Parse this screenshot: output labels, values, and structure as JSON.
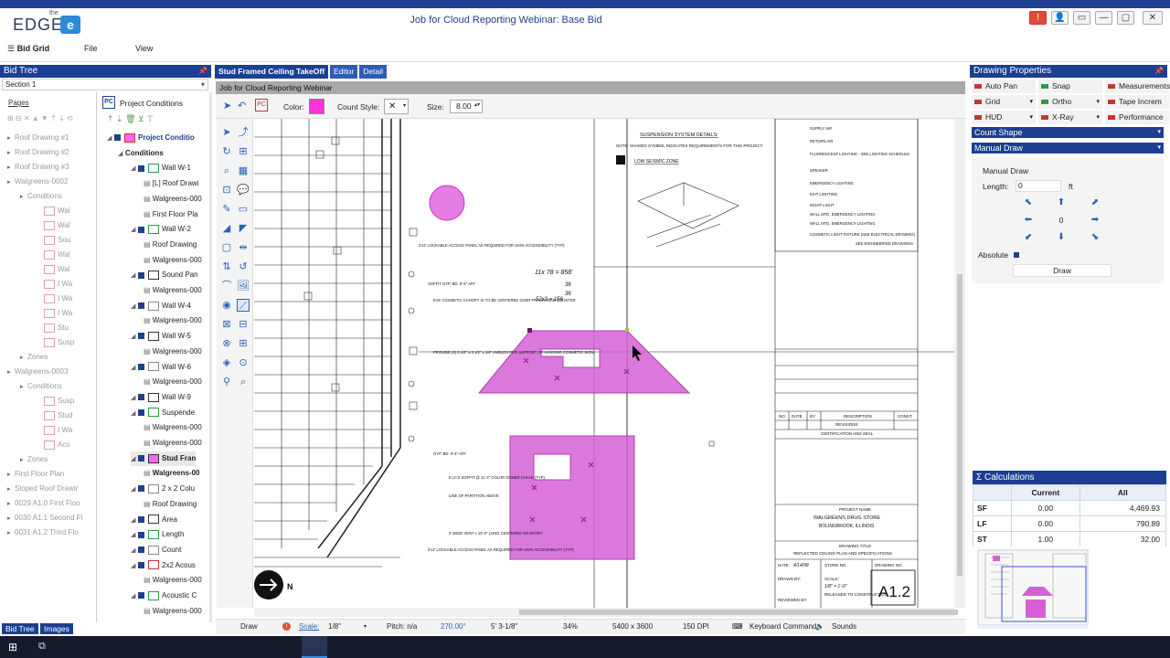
{
  "app": {
    "title": "Job for Cloud Reporting Webinar: Base Bid",
    "logo_top": "the",
    "logo_text": "EDGE",
    "logo_mark": "e"
  },
  "menu": {
    "bid_grid": "Bid Grid",
    "file": "File",
    "view": "View"
  },
  "bid_tree": {
    "header": "Bid Tree",
    "section": "Section 1",
    "pages_label": "Pages",
    "pages": [
      {
        "label": "Roof Drawing #1",
        "indent": 0
      },
      {
        "label": "Roof Drawing #2",
        "indent": 0
      },
      {
        "label": "Roof Drawing #3",
        "indent": 0
      },
      {
        "label": "Walgreens-0002",
        "indent": 0
      },
      {
        "label": "Conditions",
        "indent": 1
      },
      {
        "label": "Wal",
        "indent": 2
      },
      {
        "label": "Wal",
        "indent": 2
      },
      {
        "label": "Sou",
        "indent": 2
      },
      {
        "label": "Wal",
        "indent": 2
      },
      {
        "label": "Wal",
        "indent": 2
      },
      {
        "label": "I Wa",
        "indent": 2
      },
      {
        "label": "I Wa",
        "indent": 2
      },
      {
        "label": "I Wa",
        "indent": 2
      },
      {
        "label": "Stu",
        "indent": 2
      },
      {
        "label": "Susp",
        "indent": 2
      },
      {
        "label": "Zones",
        "indent": 1
      },
      {
        "label": "Walgreens-0003",
        "indent": 0
      },
      {
        "label": "Conditions",
        "indent": 1
      },
      {
        "label": "Susp",
        "indent": 2
      },
      {
        "label": "Stud",
        "indent": 2
      },
      {
        "label": "I Wa",
        "indent": 2
      },
      {
        "label": "Aco",
        "indent": 2
      },
      {
        "label": "Zones",
        "indent": 1
      },
      {
        "label": "First Floor Plan",
        "indent": 0
      },
      {
        "label": "Sloped Roof Drawir",
        "indent": 0
      },
      {
        "label": "0029 A1.0 First Floo",
        "indent": 0
      },
      {
        "label": "0030 A1.1 Second Fl",
        "indent": 0
      },
      {
        "label": "0031 A1.2 Third Flo",
        "indent": 0
      }
    ],
    "conditions_header": "Project Conditions",
    "conditions": [
      {
        "label": "Project Conditio",
        "level": 0,
        "bold": true
      },
      {
        "label": "Conditions",
        "level": 1,
        "bold": true
      },
      {
        "label": "Wall W-1",
        "level": 2
      },
      {
        "label": "[L] Roof Drawi",
        "level": 3
      },
      {
        "label": "Walgreens-000",
        "level": 3
      },
      {
        "label": "First Floor Pla",
        "level": 3
      },
      {
        "label": "Wall W-2",
        "level": 2
      },
      {
        "label": "Roof Drawing",
        "level": 3
      },
      {
        "label": "Walgreens-000",
        "level": 3
      },
      {
        "label": "Sound Pan",
        "level": 2
      },
      {
        "label": "Walgreens-000",
        "level": 3
      },
      {
        "label": "Wall W-4",
        "level": 2
      },
      {
        "label": "Walgreens-000",
        "level": 3
      },
      {
        "label": "Wall W-5",
        "level": 2
      },
      {
        "label": "Walgreens-000",
        "level": 3
      },
      {
        "label": "Wall W-6",
        "level": 2
      },
      {
        "label": "Walgreens-000",
        "level": 3
      },
      {
        "label": "Wall W-9",
        "level": 2
      },
      {
        "label": "Suspende",
        "level": 2
      },
      {
        "label": "Walgreens-000",
        "level": 3
      },
      {
        "label": "Walgreens-000",
        "level": 3
      },
      {
        "label": "Stud Fran",
        "level": 2,
        "bold": true
      },
      {
        "label": "Walgreens-00",
        "level": 3,
        "bold": true
      },
      {
        "label": "2 x 2 Colu",
        "level": 2
      },
      {
        "label": "Roof Drawing",
        "level": 3
      },
      {
        "label": "Area",
        "level": 2
      },
      {
        "label": "Length",
        "level": 2
      },
      {
        "label": "Count",
        "level": 2
      },
      {
        "label": "2x2 Acous",
        "level": 2
      },
      {
        "label": "Walgreens-000",
        "level": 3
      },
      {
        "label": "Acoustic C",
        "level": 2
      },
      {
        "label": "Walgreens-000",
        "level": 3
      }
    ],
    "bottom_tabs": [
      "Bid Tree",
      "Images"
    ]
  },
  "center": {
    "tabs": [
      "Stud Framed Ceiling TakeOff",
      "Editor",
      "Detail"
    ],
    "doc_title": "Job for Cloud Reporting Webinar",
    "color_label": "Color:",
    "color": "#ff33dd",
    "count_style_label": "Count Style:",
    "count_style_value": "✕",
    "size_label": "Size:",
    "size_value": "8.00"
  },
  "drawing": {
    "suspension_title": "SUSPENSION SYSTEM DETAILS:",
    "suspension_note": "NOTE: SHADED SYMBOL INDICATES REQUIREMENTS FOR THIS PROJECT.",
    "low_seismic": "LOW SEISMIC ZONE",
    "legend": [
      "SUPPLY AIR",
      "RETURN AIR",
      "FLUORESCENT LIGHTING - SEE LIGHTING SCHEDULE",
      "SPEAKER",
      "EMERGENCY LIGHTING",
      "EXIT LIGHTING",
      "NIGHT LIGHT",
      "WALL MTD. EMERGENCY LIGHTING",
      "WALL MTD. EMERGENCY LIGHTING",
      "COSMETIC LIGHT FIXTURE (SEE ELECTRICAL DRAWING)",
      "SEE ENGINEERING DRAWINGS"
    ],
    "revisions": {
      "no": "NO.",
      "date": "DATE",
      "by": "BY",
      "desc": "DESCRIPTION",
      "const": "CONST.",
      "title": "REVISIONS",
      "cert": "CERTIFICATION AND SEAL"
    },
    "project_name_label": "PROJECT NAME",
    "project_name": "WALGREENS DRUG STORE",
    "project_city": "BOLINGBROOK, ILLINOIS",
    "drawing_title_label": "DRAWING TITLE",
    "drawing_title": "REFLECTED CEILING PLAN AND SPECIFICATIONS",
    "sheet_no": "A1.2",
    "date_label": "DATE",
    "date_value": "4/14/98",
    "store_no_label": "STORE NO.",
    "drawing_no_label": "DRAWING NO.",
    "scale_label": "SCALE:",
    "scale_value": "1/8\" = 1'-0\"",
    "drawn_by": "DRAWN BY:",
    "reviewed_by": "REVIEWED BY:",
    "released": "RELEASED TO CONSTRUCTION",
    "north": "N",
    "callouts": [
      "2'x2' LOCKABLE ACCESS PANEL AS REQUIRED FOR SIGN ACCESSIBILITY (TYP)",
      "SOFFIT GYP. BD. 9'-4\" AFF",
      "6'x6' COSMETIC CANOPY IS TO BE CENTERED OVER FRAGRANCE COUNTER",
      "PROVIDE (2) 3 1/2\" x 3 1/2\" x 1/4\" ANGLES FOR SUPPORT OF HANGING COSMETIC SIGN",
      "GYP. BD. 9'-4\" AFF",
      "E.I.F.S SOFFIT @ 11'-4\" COLOR DONER CHALK (TYP)",
      "LINE OF PARTITION ABOVE",
      "2' WIDE VENT x 10'-0\" LONG CENTERED ON ENTRY",
      "2'x2' LOCKABLE ACCESS PANEL AS REQUIRED FOR SIGN ACCESSIBILITY (TYP)"
    ],
    "handwriting": [
      "11x 78 = 858'",
      "36",
      "36",
      "52x3 = 156"
    ]
  },
  "status": {
    "mode": "Draw",
    "scale_label": "Scale:",
    "scale_value": "1/8\"",
    "pitch": "Pitch: n/a",
    "angle": "270.00°",
    "length": "5' 3-1/8\"",
    "zoom": "34%",
    "dims": "5400 x 3600",
    "dpi": "150 DPI",
    "keyboard": "Keyboard Command",
    "sounds": "Sounds"
  },
  "drawing_properties": {
    "header": "Drawing Properties",
    "toggles": [
      {
        "label": "Auto Pan",
        "state": "off"
      },
      {
        "label": "Snap",
        "state": "on"
      },
      {
        "label": "Measurements",
        "state": "off"
      },
      {
        "label": "Grid",
        "state": "off"
      },
      {
        "label": "Ortho",
        "state": "on"
      },
      {
        "label": "Tape Increm",
        "state": "off"
      },
      {
        "label": "HUD",
        "state": "off"
      },
      {
        "label": "X-Ray",
        "state": "off"
      },
      {
        "label": "Performance",
        "state": "off"
      }
    ],
    "count_shape": "Count Shape",
    "manual_draw": "Manual Draw",
    "manual_draw_title": "Manual Draw",
    "length_label": "Length:",
    "length_value": "0",
    "length_unit": "ft",
    "center_value": "0",
    "absolute_label": "Absolute",
    "draw_button": "Draw"
  },
  "calculations": {
    "header": "Calculations",
    "columns": [
      "",
      "Current",
      "All"
    ],
    "rows": [
      [
        "SF",
        "0.00",
        "4,469.93"
      ],
      [
        "LF",
        "0.00",
        "790.89"
      ],
      [
        "ST",
        "1.00",
        "32.00"
      ]
    ]
  }
}
